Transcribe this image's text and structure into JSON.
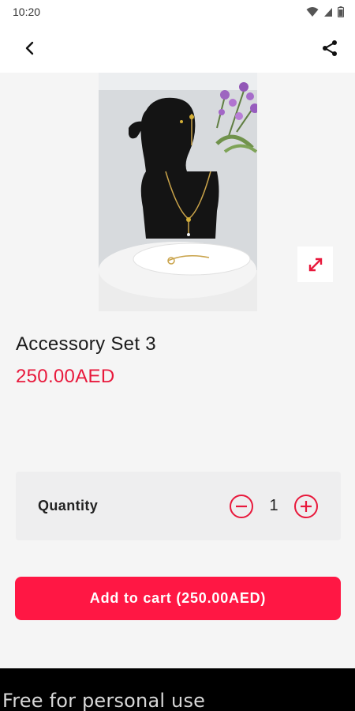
{
  "status_bar": {
    "time": "10:20"
  },
  "app_bar": {
    "back_icon": "back-arrow-icon",
    "share_icon": "share-icon"
  },
  "product": {
    "title": "Accessory Set 3",
    "price": "250.00AED",
    "image_description_icon": "expand-icon"
  },
  "quantity": {
    "label": "Quantity",
    "value": "1",
    "decrement_icon": "minus-circle-icon",
    "increment_icon": "plus-circle-icon"
  },
  "cart": {
    "button_label": "Add to cart (250.00AED)"
  },
  "banner": {
    "text": "Free for personal use"
  },
  "colors": {
    "accent": "#ff1744",
    "price": "#e8193c",
    "panel": "#eeeeef",
    "background": "#f5f5f5"
  }
}
